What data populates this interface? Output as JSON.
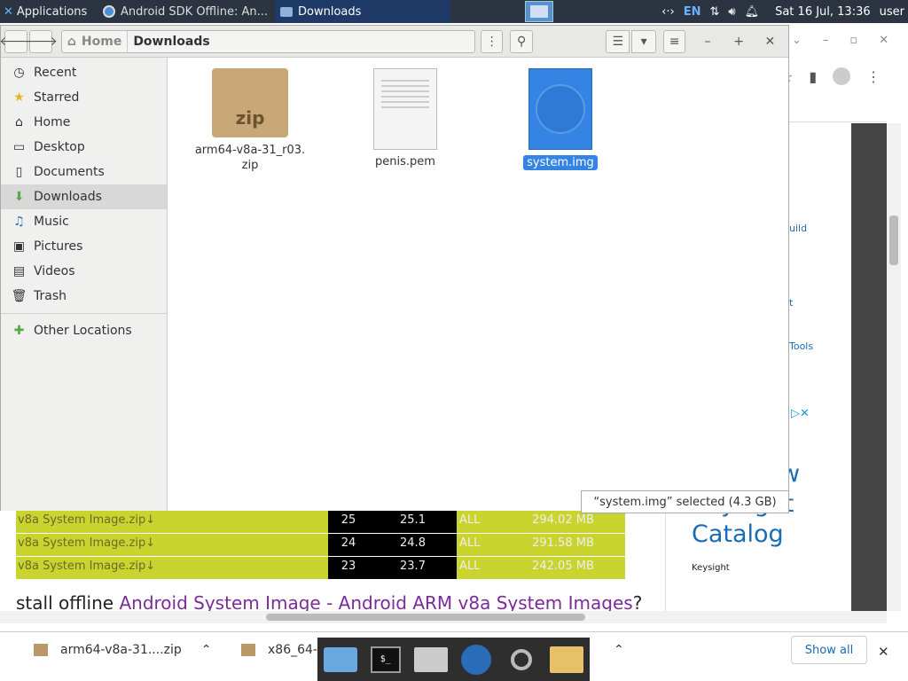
{
  "taskbar": {
    "apps_label": "Applications",
    "tasks": [
      {
        "label": "Android SDK Offline: An..."
      },
      {
        "label": "Downloads"
      }
    ],
    "lang": "EN",
    "datetime": "Sat 16 Jul, 13:36",
    "user": "user"
  },
  "file_manager": {
    "path": {
      "home": "Home",
      "current": "Downloads"
    },
    "sidebar": [
      {
        "label": "Recent",
        "icon": "clock-icon"
      },
      {
        "label": "Starred",
        "icon": "star-icon"
      },
      {
        "label": "Home",
        "icon": "home-icon"
      },
      {
        "label": "Desktop",
        "icon": "desktop-icon"
      },
      {
        "label": "Documents",
        "icon": "document-icon"
      },
      {
        "label": "Downloads",
        "icon": "download-icon",
        "active": true
      },
      {
        "label": "Music",
        "icon": "music-icon"
      },
      {
        "label": "Pictures",
        "icon": "picture-icon"
      },
      {
        "label": "Videos",
        "icon": "video-icon"
      },
      {
        "label": "Trash",
        "icon": "trash-icon"
      }
    ],
    "other_locations": "Other Locations",
    "files": [
      {
        "name": "arm64-v8a-31_r03.\nzip",
        "icon": "zip-archive-icon"
      },
      {
        "name": "penis.pem",
        "icon": "text-file-icon"
      },
      {
        "name": "system.img",
        "icon": "disc-image-icon",
        "selected": true
      }
    ],
    "status": "“system.img” selected  (4.3 GB)"
  },
  "browser": {
    "downloads_table": [
      [
        "v8a System Image.zip↓",
        "25",
        "25.1",
        "ALL",
        "294.02 MB"
      ],
      [
        "v8a System Image.zip↓",
        "24",
        "24.8",
        "ALL",
        "291.58 MB"
      ],
      [
        "v8a System Image.zip↓",
        "23",
        "23.7",
        "ALL",
        "242.05 MB"
      ]
    ],
    "heading_prefix": "stall offline ",
    "heading_link": "Android System Image - Android ARM v8a System Images",
    "heading_suffix": "?",
    "side_labels": [
      "uild",
      "t",
      "Tools"
    ],
    "ad": {
      "line1": "w",
      "line2": "Keysight",
      "line3": "Catalog",
      "brand": "Keysight"
    }
  },
  "shelf": {
    "items": [
      "arm64-v8a-31....zip",
      "x86_64-"
    ],
    "show_all": "Show all"
  },
  "colors": {
    "accent": "#3584e4",
    "taskbar": "#2b3440",
    "table_green": "#c9d42e"
  }
}
